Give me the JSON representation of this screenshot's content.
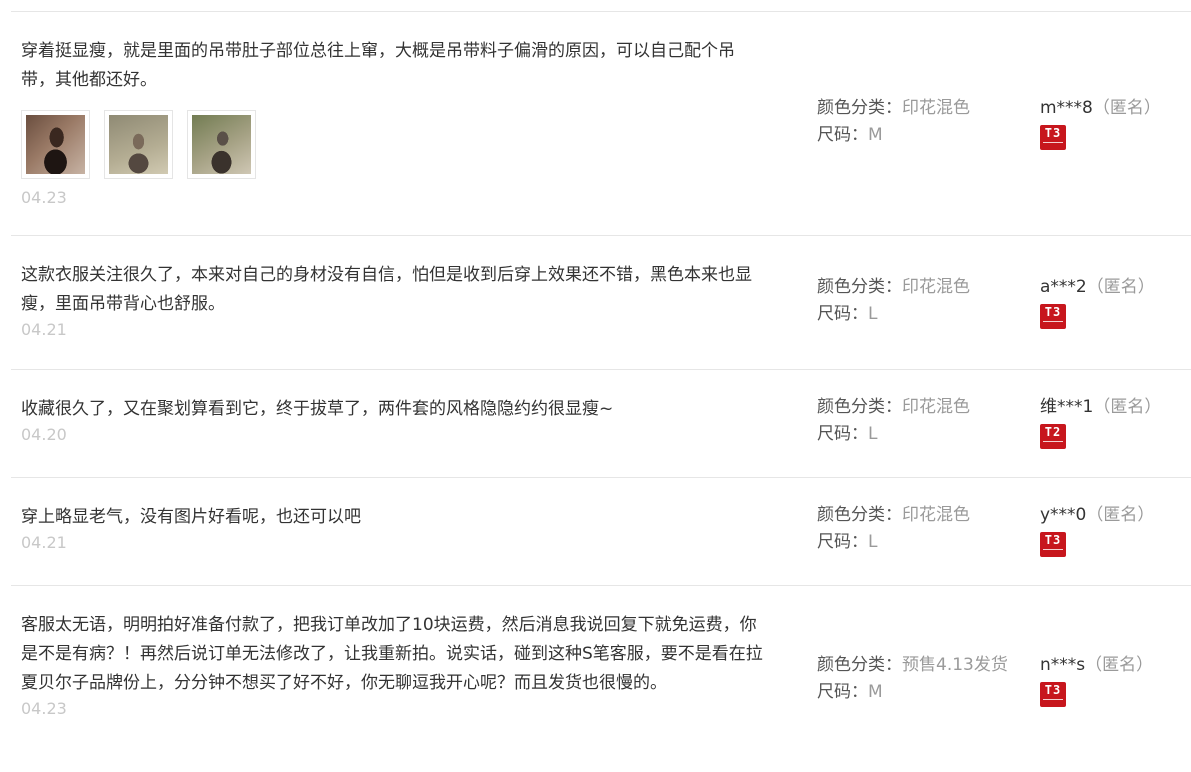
{
  "labels": {
    "color": "颜色分类：",
    "size": "尺码："
  },
  "colors": {
    "badge_bg": "#c7161d",
    "date": "#c8c8c8",
    "divider": "#e6e6e6"
  },
  "reviews": [
    {
      "text": "穿着挺显瘦，就是里面的吊带肚子部位总往上窜，大概是吊带料子偏滑的原因，可以自己配个吊带，其他都还好。",
      "date": "04.23",
      "color_val": "印花混色",
      "size_val": "M",
      "nick": "m***8",
      "anon": "（匿名）",
      "badge": "T3",
      "photos": [
        "photo-1",
        "photo-2",
        "photo-3"
      ]
    },
    {
      "text": "这款衣服关注很久了，本来对自己的身材没有自信，怕但是收到后穿上效果还不错，黑色本来也显瘦，里面吊带背心也舒服。",
      "date": "04.21",
      "color_val": "印花混色",
      "size_val": "L",
      "nick": "a***2",
      "anon": "（匿名）",
      "badge": "T3"
    },
    {
      "text": "收藏很久了，又在聚划算看到它，终于拔草了，两件套的风格隐隐约约很显瘦~",
      "date": "04.20",
      "color_val": "印花混色",
      "size_val": "L",
      "nick": "维***1",
      "anon": "（匿名）",
      "badge": "T2"
    },
    {
      "text": "穿上略显老气，没有图片好看呢，也还可以吧",
      "date": "04.21",
      "color_val": "印花混色",
      "size_val": "L",
      "nick": "y***0",
      "anon": "（匿名）",
      "badge": "T3"
    },
    {
      "text": "客服太无语，明明拍好准备付款了，把我订单改加了10块运费，然后消息我说回复下就免运费，你是不是有病？！再然后说订单无法修改了，让我重新拍。说实话，碰到这种S笔客服，要不是看在拉夏贝尔子品牌份上，分分钟不想买了好不好，你无聊逗我开心呢？而且发货也很慢的。",
      "date": "04.23",
      "color_val": "预售4.13发货",
      "size_val": "M",
      "nick": "n***s",
      "anon": "（匿名）",
      "badge": "T3"
    }
  ]
}
